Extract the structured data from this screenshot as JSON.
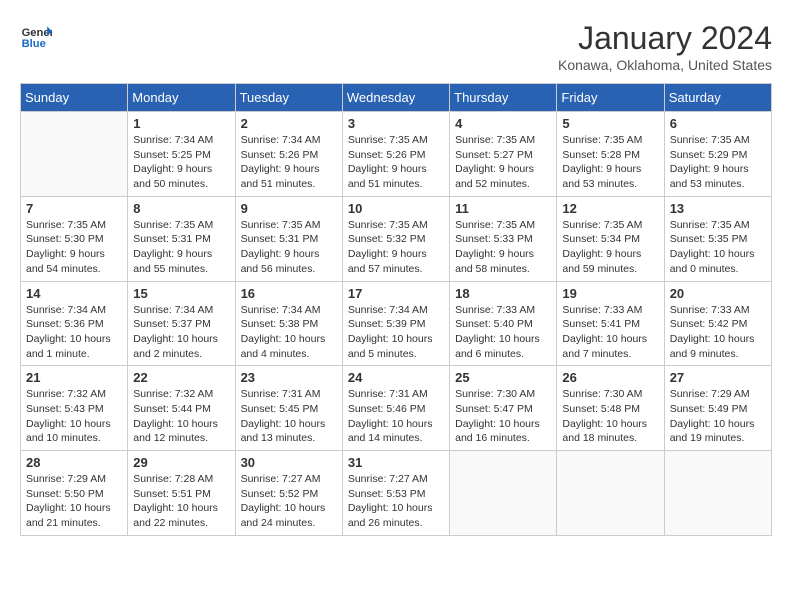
{
  "logo": {
    "text_general": "General",
    "text_blue": "Blue"
  },
  "title": "January 2024",
  "location": "Konawa, Oklahoma, United States",
  "weekdays": [
    "Sunday",
    "Monday",
    "Tuesday",
    "Wednesday",
    "Thursday",
    "Friday",
    "Saturday"
  ],
  "weeks": [
    [
      {
        "day": "",
        "empty": true
      },
      {
        "day": "1",
        "sunrise": "Sunrise: 7:34 AM",
        "sunset": "Sunset: 5:25 PM",
        "daylight": "Daylight: 9 hours and 50 minutes."
      },
      {
        "day": "2",
        "sunrise": "Sunrise: 7:34 AM",
        "sunset": "Sunset: 5:26 PM",
        "daylight": "Daylight: 9 hours and 51 minutes."
      },
      {
        "day": "3",
        "sunrise": "Sunrise: 7:35 AM",
        "sunset": "Sunset: 5:26 PM",
        "daylight": "Daylight: 9 hours and 51 minutes."
      },
      {
        "day": "4",
        "sunrise": "Sunrise: 7:35 AM",
        "sunset": "Sunset: 5:27 PM",
        "daylight": "Daylight: 9 hours and 52 minutes."
      },
      {
        "day": "5",
        "sunrise": "Sunrise: 7:35 AM",
        "sunset": "Sunset: 5:28 PM",
        "daylight": "Daylight: 9 hours and 53 minutes."
      },
      {
        "day": "6",
        "sunrise": "Sunrise: 7:35 AM",
        "sunset": "Sunset: 5:29 PM",
        "daylight": "Daylight: 9 hours and 53 minutes."
      }
    ],
    [
      {
        "day": "7",
        "sunrise": "Sunrise: 7:35 AM",
        "sunset": "Sunset: 5:30 PM",
        "daylight": "Daylight: 9 hours and 54 minutes."
      },
      {
        "day": "8",
        "sunrise": "Sunrise: 7:35 AM",
        "sunset": "Sunset: 5:31 PM",
        "daylight": "Daylight: 9 hours and 55 minutes."
      },
      {
        "day": "9",
        "sunrise": "Sunrise: 7:35 AM",
        "sunset": "Sunset: 5:31 PM",
        "daylight": "Daylight: 9 hours and 56 minutes."
      },
      {
        "day": "10",
        "sunrise": "Sunrise: 7:35 AM",
        "sunset": "Sunset: 5:32 PM",
        "daylight": "Daylight: 9 hours and 57 minutes."
      },
      {
        "day": "11",
        "sunrise": "Sunrise: 7:35 AM",
        "sunset": "Sunset: 5:33 PM",
        "daylight": "Daylight: 9 hours and 58 minutes."
      },
      {
        "day": "12",
        "sunrise": "Sunrise: 7:35 AM",
        "sunset": "Sunset: 5:34 PM",
        "daylight": "Daylight: 9 hours and 59 minutes."
      },
      {
        "day": "13",
        "sunrise": "Sunrise: 7:35 AM",
        "sunset": "Sunset: 5:35 PM",
        "daylight": "Daylight: 10 hours and 0 minutes."
      }
    ],
    [
      {
        "day": "14",
        "sunrise": "Sunrise: 7:34 AM",
        "sunset": "Sunset: 5:36 PM",
        "daylight": "Daylight: 10 hours and 1 minute."
      },
      {
        "day": "15",
        "sunrise": "Sunrise: 7:34 AM",
        "sunset": "Sunset: 5:37 PM",
        "daylight": "Daylight: 10 hours and 2 minutes."
      },
      {
        "day": "16",
        "sunrise": "Sunrise: 7:34 AM",
        "sunset": "Sunset: 5:38 PM",
        "daylight": "Daylight: 10 hours and 4 minutes."
      },
      {
        "day": "17",
        "sunrise": "Sunrise: 7:34 AM",
        "sunset": "Sunset: 5:39 PM",
        "daylight": "Daylight: 10 hours and 5 minutes."
      },
      {
        "day": "18",
        "sunrise": "Sunrise: 7:33 AM",
        "sunset": "Sunset: 5:40 PM",
        "daylight": "Daylight: 10 hours and 6 minutes."
      },
      {
        "day": "19",
        "sunrise": "Sunrise: 7:33 AM",
        "sunset": "Sunset: 5:41 PM",
        "daylight": "Daylight: 10 hours and 7 minutes."
      },
      {
        "day": "20",
        "sunrise": "Sunrise: 7:33 AM",
        "sunset": "Sunset: 5:42 PM",
        "daylight": "Daylight: 10 hours and 9 minutes."
      }
    ],
    [
      {
        "day": "21",
        "sunrise": "Sunrise: 7:32 AM",
        "sunset": "Sunset: 5:43 PM",
        "daylight": "Daylight: 10 hours and 10 minutes."
      },
      {
        "day": "22",
        "sunrise": "Sunrise: 7:32 AM",
        "sunset": "Sunset: 5:44 PM",
        "daylight": "Daylight: 10 hours and 12 minutes."
      },
      {
        "day": "23",
        "sunrise": "Sunrise: 7:31 AM",
        "sunset": "Sunset: 5:45 PM",
        "daylight": "Daylight: 10 hours and 13 minutes."
      },
      {
        "day": "24",
        "sunrise": "Sunrise: 7:31 AM",
        "sunset": "Sunset: 5:46 PM",
        "daylight": "Daylight: 10 hours and 14 minutes."
      },
      {
        "day": "25",
        "sunrise": "Sunrise: 7:30 AM",
        "sunset": "Sunset: 5:47 PM",
        "daylight": "Daylight: 10 hours and 16 minutes."
      },
      {
        "day": "26",
        "sunrise": "Sunrise: 7:30 AM",
        "sunset": "Sunset: 5:48 PM",
        "daylight": "Daylight: 10 hours and 18 minutes."
      },
      {
        "day": "27",
        "sunrise": "Sunrise: 7:29 AM",
        "sunset": "Sunset: 5:49 PM",
        "daylight": "Daylight: 10 hours and 19 minutes."
      }
    ],
    [
      {
        "day": "28",
        "sunrise": "Sunrise: 7:29 AM",
        "sunset": "Sunset: 5:50 PM",
        "daylight": "Daylight: 10 hours and 21 minutes."
      },
      {
        "day": "29",
        "sunrise": "Sunrise: 7:28 AM",
        "sunset": "Sunset: 5:51 PM",
        "daylight": "Daylight: 10 hours and 22 minutes."
      },
      {
        "day": "30",
        "sunrise": "Sunrise: 7:27 AM",
        "sunset": "Sunset: 5:52 PM",
        "daylight": "Daylight: 10 hours and 24 minutes."
      },
      {
        "day": "31",
        "sunrise": "Sunrise: 7:27 AM",
        "sunset": "Sunset: 5:53 PM",
        "daylight": "Daylight: 10 hours and 26 minutes."
      },
      {
        "day": "",
        "empty": true
      },
      {
        "day": "",
        "empty": true
      },
      {
        "day": "",
        "empty": true
      }
    ]
  ]
}
